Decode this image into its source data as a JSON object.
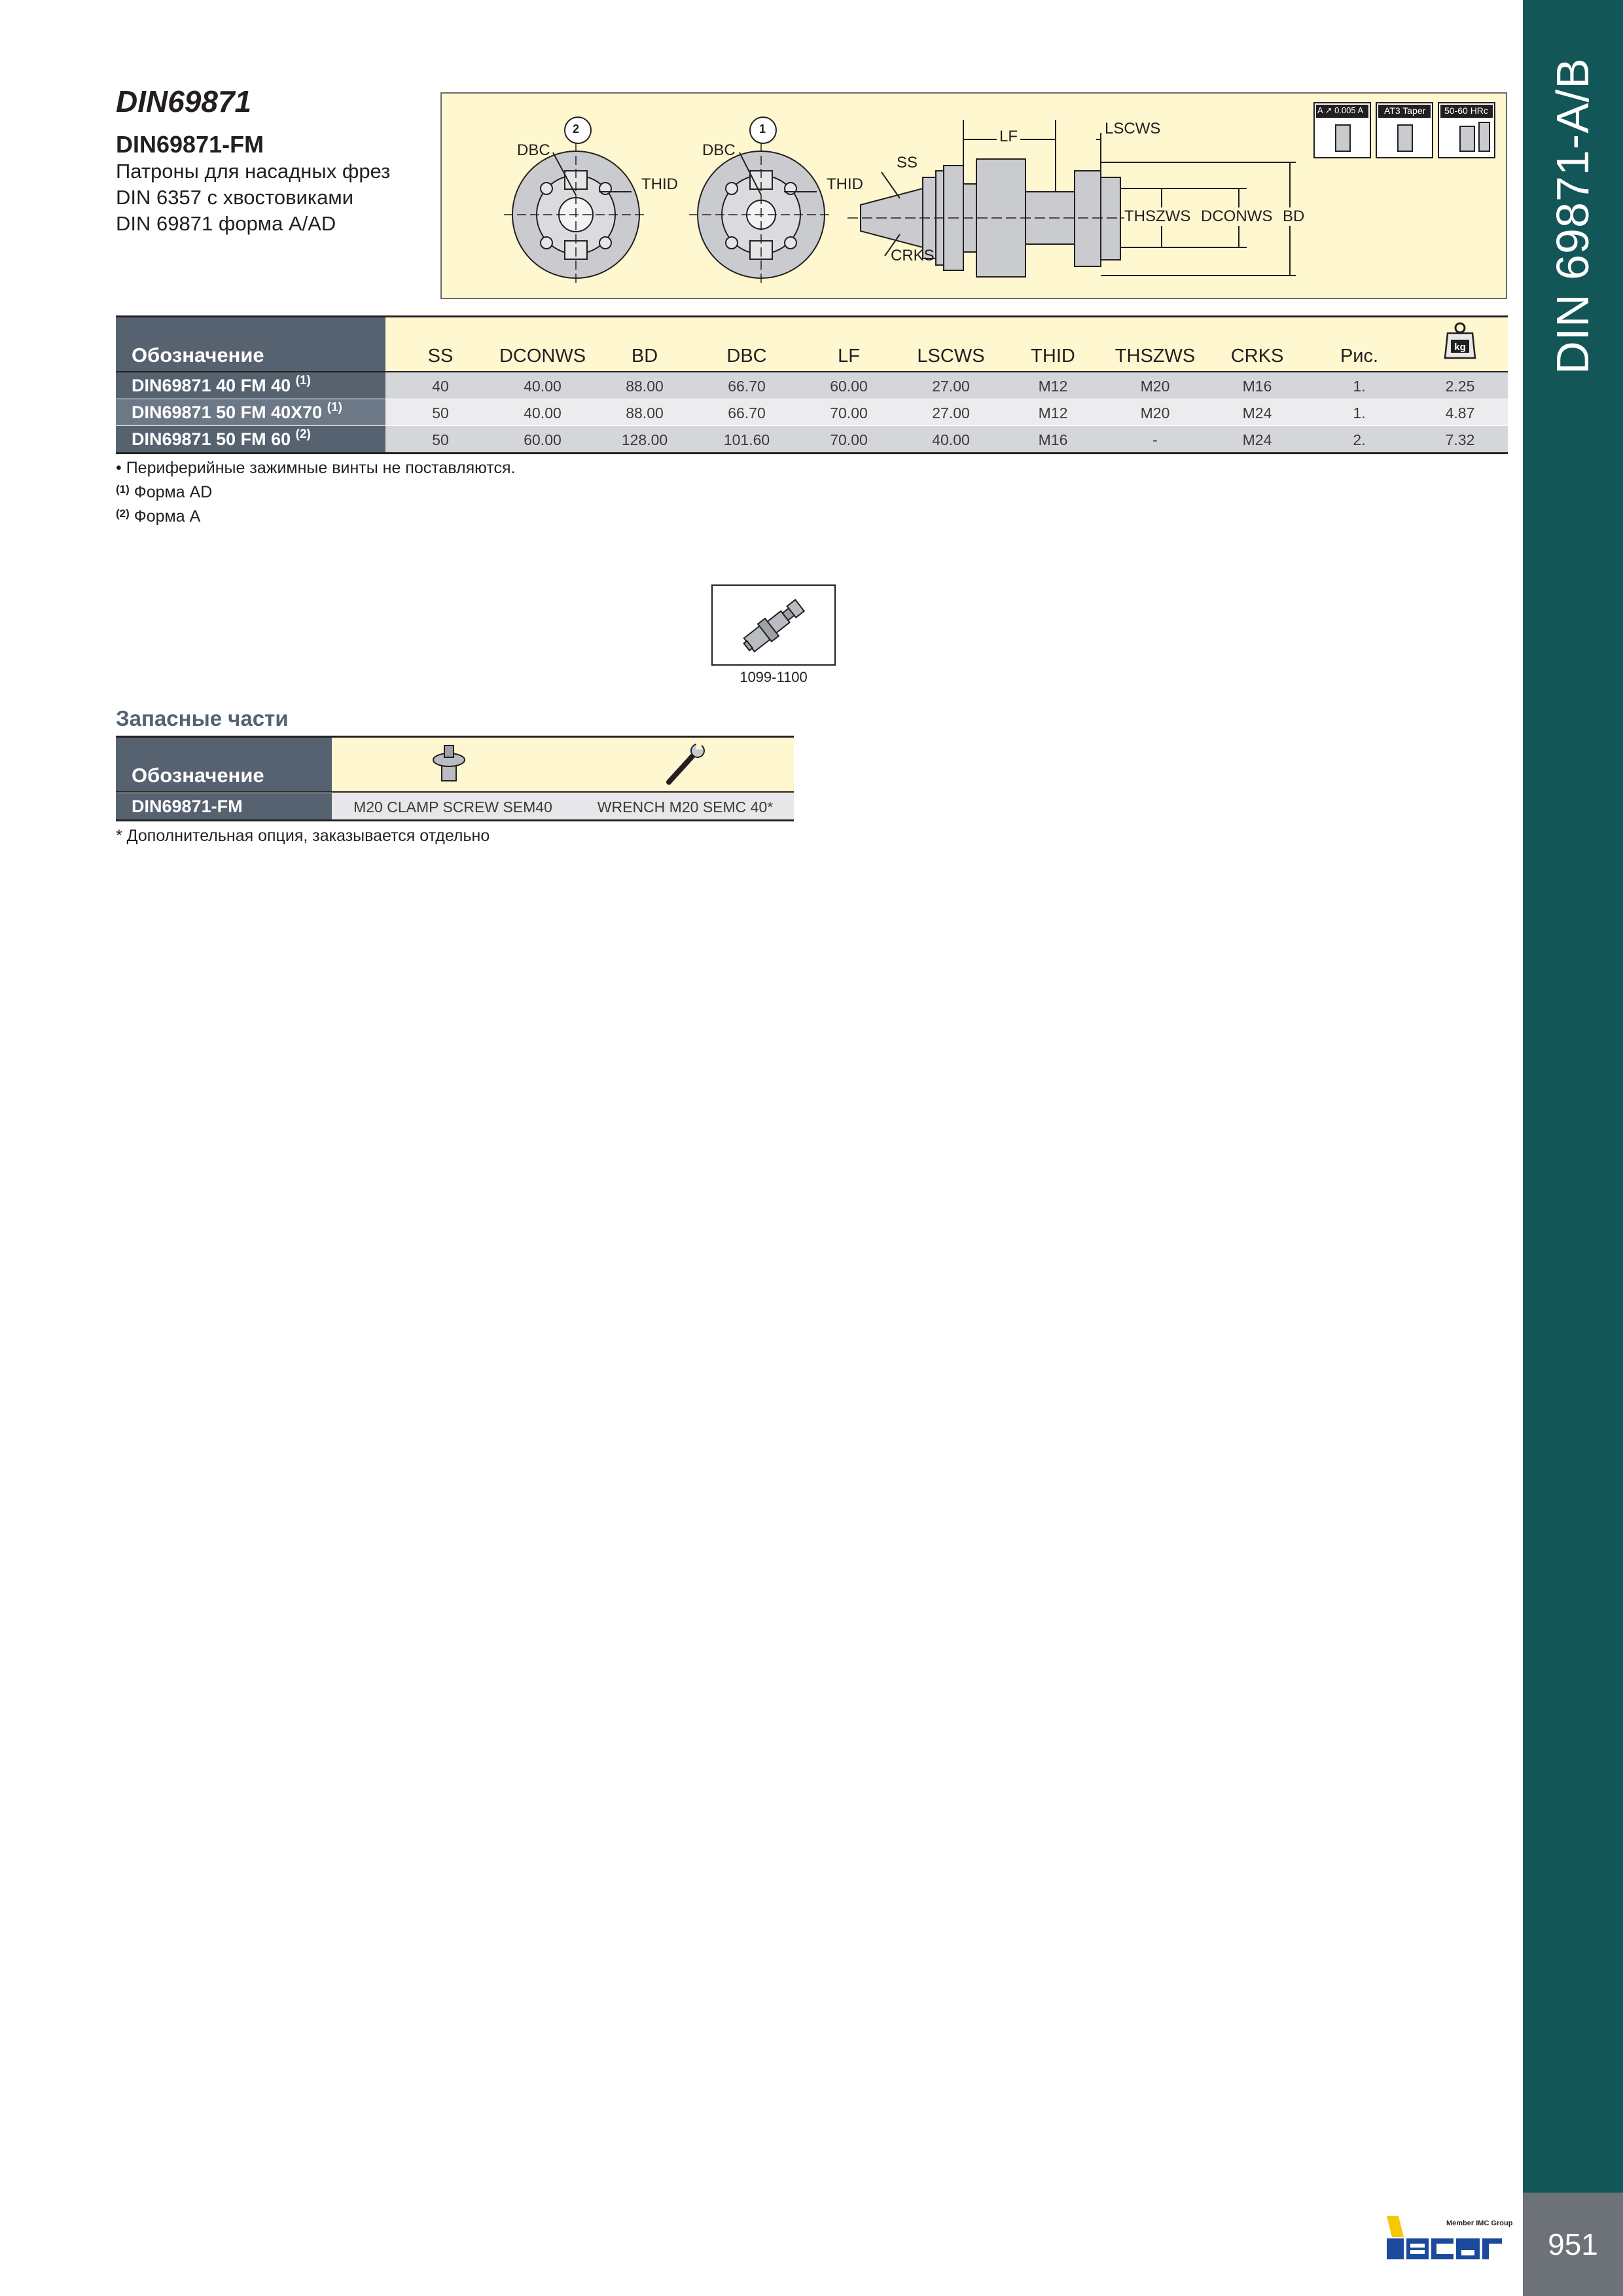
{
  "side_band": {
    "title": "DIN 69871-A/B",
    "color": "#135657"
  },
  "page_number": "951",
  "header": {
    "title": "DIN69871",
    "subtitle": "DIN69871-FM",
    "description_lines": [
      "Патроны для насадных фрез",
      "DIN 6357 с хвостовиками",
      "DIN 69871 форма A/AD"
    ]
  },
  "drawing": {
    "labels": {
      "fig2": "2",
      "fig1": "1",
      "dbc": "DBC",
      "thid": "THID",
      "ss": "SS",
      "crks": "CRKS",
      "lf": "LF",
      "lscws": "LSCWS",
      "thszws": "THSZWS",
      "dconws": "DCONWS",
      "bd": "BD"
    },
    "badges": [
      "A ↗ 0.005 A",
      "AT3 Taper",
      "50-60 HRc"
    ]
  },
  "table": {
    "name_header": "Обозначение",
    "columns": [
      "SS",
      "DCONWS",
      "BD",
      "DBC",
      "LF",
      "LSCWS",
      "THID",
      "THSZWS",
      "CRKS",
      "Рис."
    ],
    "weight_icon": "kg",
    "rows": [
      {
        "name": "DIN69871 40 FM 40",
        "ref": "(1)",
        "values": [
          "40",
          "40.00",
          "88.00",
          "66.70",
          "60.00",
          "27.00",
          "M12",
          "M20",
          "M16",
          "1.",
          "2.25"
        ]
      },
      {
        "name": "DIN69871 50 FM 40X70",
        "ref": "(1)",
        "values": [
          "50",
          "40.00",
          "88.00",
          "66.70",
          "70.00",
          "27.00",
          "M12",
          "M20",
          "M24",
          "1.",
          "4.87"
        ]
      },
      {
        "name": "DIN69871 50 FM 60",
        "ref": "(2)",
        "values": [
          "50",
          "60.00",
          "128.00",
          "101.60",
          "70.00",
          "40.00",
          "M16",
          "-",
          "M24",
          "2.",
          "7.32"
        ]
      }
    ],
    "row_colors": [
      "#d4d6da",
      "#ececef",
      "#d4d6da"
    ]
  },
  "notes": {
    "bullet": "• Периферийные зажимные винты не поставляются.",
    "n1_mark": "(1)",
    "n1_text": " Форма AD",
    "n2_mark": "(2)",
    "n2_text": " Форма A"
  },
  "pull_stud": {
    "label": "1099-1100"
  },
  "spare_parts": {
    "title": "Запасные части",
    "name_header": "Обозначение",
    "row": {
      "name": "DIN69871-FM",
      "items": [
        "M20 CLAMP SCREW SEM40",
        "WRENCH M20 SEMC 40*"
      ]
    },
    "footnote": "*  Дополнительная опция, заказывается отдельно"
  },
  "logo": {
    "brand": "iscar",
    "tagline": "Member IMC Group",
    "colors": {
      "yellow": "#f5c800",
      "blue": "#1b4a9c"
    }
  }
}
